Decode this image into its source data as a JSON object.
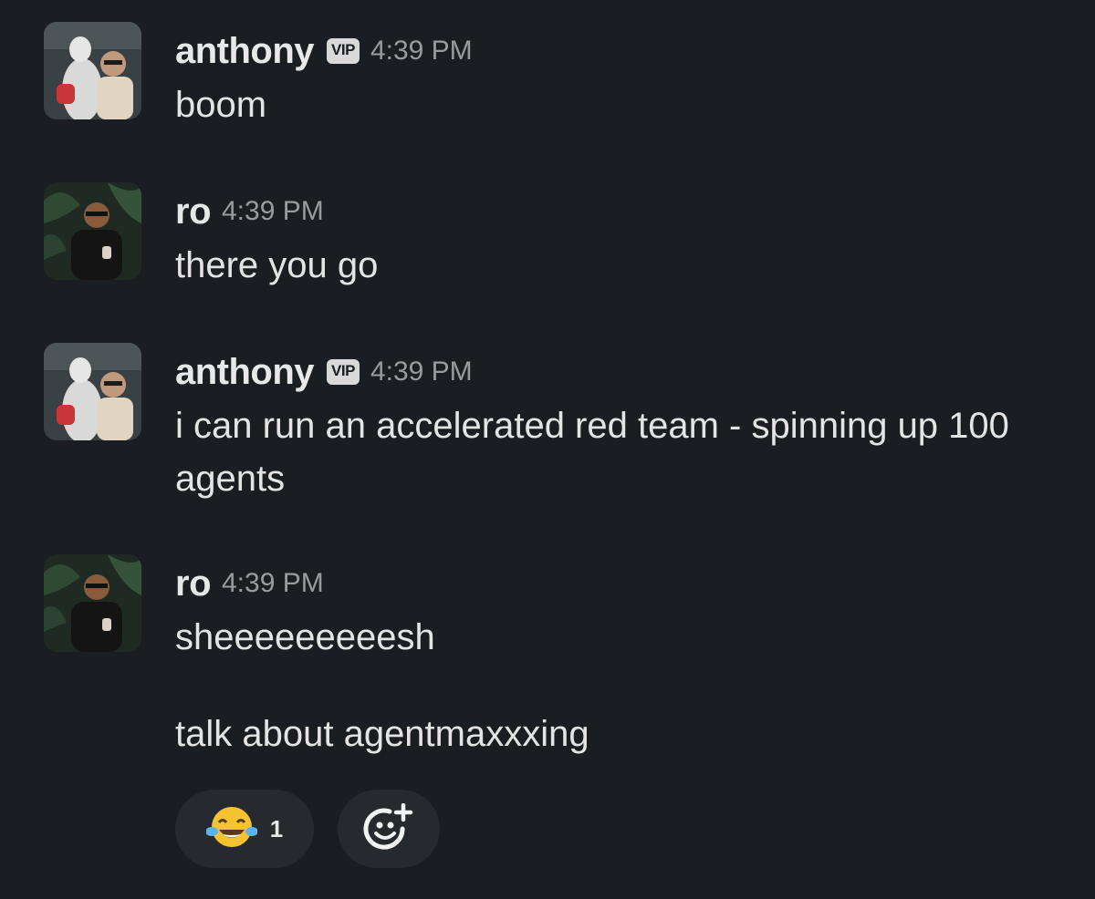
{
  "messages": [
    {
      "sender": "anthony",
      "badge": "VIP",
      "time": "4:39 PM",
      "lines": [
        "boom"
      ]
    },
    {
      "sender": "ro",
      "badge": "",
      "time": "4:39 PM",
      "lines": [
        "there you go"
      ]
    },
    {
      "sender": "anthony",
      "badge": "VIP",
      "time": "4:39 PM",
      "lines": [
        "i can run an accelerated red team - spinning up 100 agents"
      ]
    },
    {
      "sender": "ro",
      "badge": "",
      "time": "4:39 PM",
      "lines": [
        "sheeeeeeeeesh",
        "talk about agentmaxxxing"
      ]
    }
  ],
  "reactions": [
    {
      "emoji": "face-with-tears-of-joy-icon",
      "count": "1"
    },
    {
      "emoji": "add-reaction-icon",
      "count": ""
    }
  ],
  "colors": {
    "background": "#1a1d21",
    "text": "#e4e4e4",
    "timestamp": "#9a9b9d",
    "badge_bg": "#d9d9d9",
    "reaction_bg": "#26292e"
  }
}
